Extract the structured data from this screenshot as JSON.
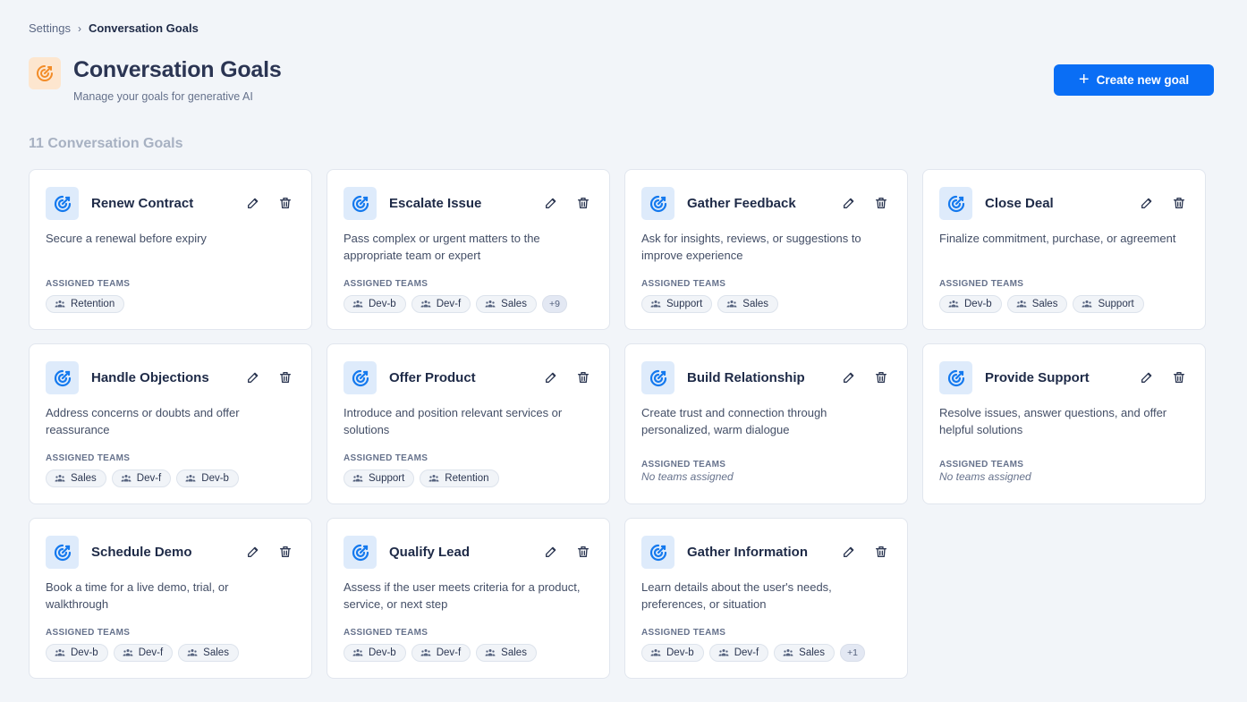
{
  "breadcrumb": {
    "parent": "Settings",
    "current": "Conversation Goals"
  },
  "header": {
    "title": "Conversation Goals",
    "subtitle": "Manage your goals for generative AI",
    "create_label": "Create new goal"
  },
  "goal_count_label": "11 Conversation Goals",
  "teams_label": "ASSIGNED TEAMS",
  "no_teams_text": "No teams assigned",
  "colors": {
    "accent": "#0a6ef5",
    "header_icon": "#f28c28",
    "goal_icon": "#1479ee"
  },
  "goals": [
    {
      "title": "Renew Contract",
      "description": "Secure a renewal before expiry",
      "teams": [
        "Retention"
      ],
      "more": ""
    },
    {
      "title": "Escalate Issue",
      "description": "Pass complex or urgent matters to the appropriate team or expert",
      "teams": [
        "Dev-b",
        "Dev-f",
        "Sales"
      ],
      "more": "+9"
    },
    {
      "title": "Gather Feedback",
      "description": "Ask for insights, reviews, or suggestions to improve experience",
      "teams": [
        "Support",
        "Sales"
      ],
      "more": ""
    },
    {
      "title": "Close Deal",
      "description": "Finalize commitment, purchase, or agreement",
      "teams": [
        "Dev-b",
        "Sales",
        "Support"
      ],
      "more": ""
    },
    {
      "title": "Handle Objections",
      "description": "Address concerns or doubts and offer reassurance",
      "teams": [
        "Sales",
        "Dev-f",
        "Dev-b"
      ],
      "more": ""
    },
    {
      "title": "Offer Product",
      "description": "Introduce and position relevant services or solutions",
      "teams": [
        "Support",
        "Retention"
      ],
      "more": ""
    },
    {
      "title": "Build Relationship",
      "description": "Create trust and connection through personalized, warm dialogue",
      "teams": [],
      "more": ""
    },
    {
      "title": "Provide Support",
      "description": "Resolve issues, answer questions, and offer helpful solutions",
      "teams": [],
      "more": ""
    },
    {
      "title": "Schedule Demo",
      "description": "Book a time for a live demo, trial, or walkthrough",
      "teams": [
        "Dev-b",
        "Dev-f",
        "Sales"
      ],
      "more": ""
    },
    {
      "title": "Qualify Lead",
      "description": "Assess if the user meets criteria for a product, service, or next step",
      "teams": [
        "Dev-b",
        "Dev-f",
        "Sales"
      ],
      "more": ""
    },
    {
      "title": "Gather Information",
      "description": "Learn details about the user's needs, preferences, or situation",
      "teams": [
        "Dev-b",
        "Dev-f",
        "Sales"
      ],
      "more": "+1"
    }
  ]
}
